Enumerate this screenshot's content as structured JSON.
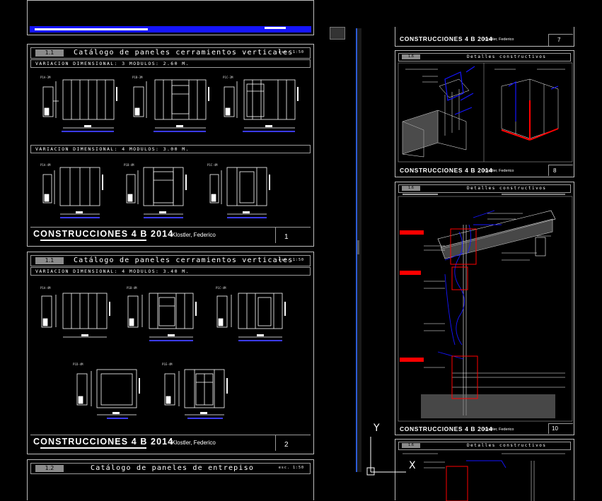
{
  "sheet1": {
    "section_number": "1.1",
    "title": "Catálogo de paneles cerramientos verticales",
    "scale": "esc. 1:50",
    "row1_label": "VARIACION DIMENSIONAL: 3 MODULOS: 2.60 M.",
    "row1_panels": [
      "P1A-3M",
      "P1B-3M",
      "P1C-3M"
    ],
    "row2_label": "VARIACION DIMENSIONAL: 4 MODULOS: 3.00 M.",
    "row2_panels": [
      "P1A-4M",
      "P1B-4M",
      "P1C-4M"
    ],
    "brand": "CONSTRUCCIONES 4 B 2014",
    "author": "Klostler, Federico",
    "page": "1"
  },
  "sheet2": {
    "section_number": "1.1",
    "title": "Catálogo de paneles cerramientos verticales",
    "scale": "esc. 1:50",
    "row1_label": "VARIACION DIMENSIONAL: 4 MODULOS: 3.40 M.",
    "row1_panels": [
      "P1A-4M",
      "P1B-4M",
      "P1C-4M"
    ],
    "row2_panels": [
      "P1D-4M",
      "P1E-4M"
    ],
    "brand": "CONSTRUCCIONES 4 B 2014",
    "author": "Klostler, Federico",
    "page": "2"
  },
  "sheet3": {
    "section_number": "1.2",
    "title": "Catálogo de paneles de entrepiso",
    "scale": "esc. 1:50"
  },
  "right_sheet7": {
    "brand": "CONSTRUCCIONES 4 B 2014",
    "author": "Klostler, Federico",
    "page": "7"
  },
  "right_sheet8": {
    "section_number": "1.6",
    "title": "Detalles constructivos",
    "brand": "CONSTRUCCIONES 4 B 2014",
    "author": "Klostler, Federico",
    "page": "8"
  },
  "right_sheet10": {
    "section_number": "1.6",
    "title": "Detalles constructivos",
    "brand": "CONSTRUCCIONES 4 B 2014",
    "author": "Klostler, Federico",
    "page": "10"
  },
  "right_sheet11": {
    "section_number": "1.6",
    "title": "Detalles constructivos"
  },
  "ucs": {
    "y_label": "Y",
    "x_label": "X"
  },
  "colors": {
    "background": "#000000",
    "accent_blue": "#1515ff",
    "highlight_red": "#ff0000",
    "line_gray": "#bdbdbd"
  }
}
